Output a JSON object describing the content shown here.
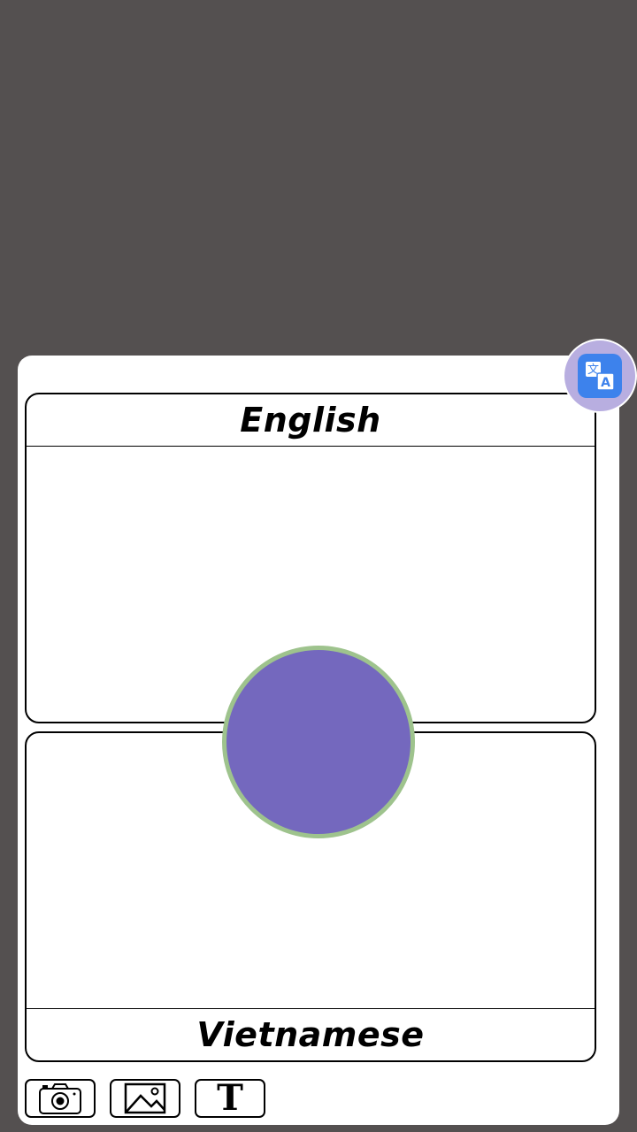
{
  "source_language": {
    "label": "English",
    "text": ""
  },
  "target_language": {
    "label": "Vietnamese",
    "text": ""
  },
  "toolbar": {
    "camera_icon": "camera-icon",
    "image_icon": "image-icon",
    "text_icon": "text-icon",
    "text_glyph": "T"
  },
  "fab": {
    "icon": "translate-icon"
  },
  "colors": {
    "background": "#545050",
    "sheet": "#ffffff",
    "swap_circle_fill": "#7468be",
    "swap_circle_border": "#9ec38d",
    "fab_outer": "#b8aee0",
    "fab_inner": "#3d82ec"
  }
}
